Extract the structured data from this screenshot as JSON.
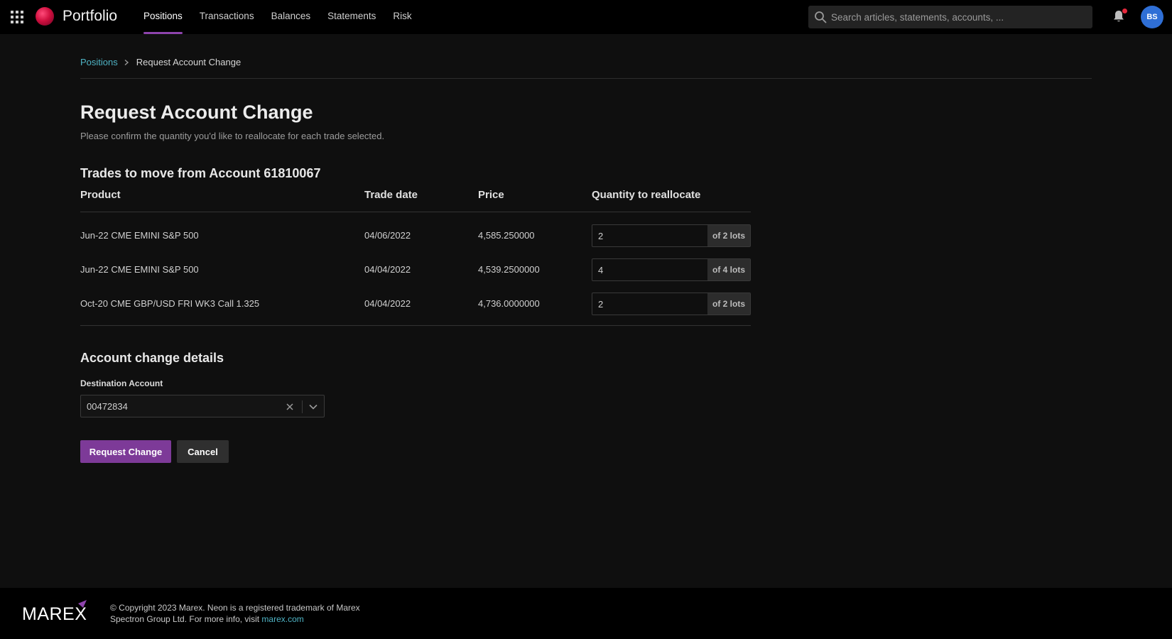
{
  "header": {
    "app_title": "Portfolio",
    "nav": [
      {
        "label": "Positions",
        "active": true
      },
      {
        "label": "Transactions"
      },
      {
        "label": "Balances"
      },
      {
        "label": "Statements"
      },
      {
        "label": "Risk"
      }
    ],
    "search_placeholder": "Search articles, statements, accounts, ...",
    "avatar_initials": "BS",
    "icons": [
      "apps-grid-icon",
      "logo-orb",
      "search-icon",
      "bell-icon"
    ],
    "colors": {
      "accent": "#8e44ad",
      "link": "#4fb3c4",
      "notification": "#e5283c",
      "avatar": "#2f6fd6"
    }
  },
  "breadcrumb": {
    "parent": "Positions",
    "current": "Request Account Change"
  },
  "page": {
    "title": "Request Account Change",
    "subtitle": "Please confirm the quantity you'd like to reallocate for each trade selected."
  },
  "trades": {
    "title": "Trades to move from Account 61810067",
    "columns": [
      "Product",
      "Trade date",
      "Price",
      "Quantity to reallocate"
    ],
    "rows": [
      {
        "product": "Jun-22 CME EMINI S&P 500",
        "trade_date": "04/06/2022",
        "price": "4,585.250000",
        "quantity": "2",
        "of_lots": "of 2 lots"
      },
      {
        "product": "Jun-22 CME EMINI S&P 500",
        "trade_date": "04/04/2022",
        "price": "4,539.2500000",
        "quantity": "4",
        "of_lots": "of 4 lots"
      },
      {
        "product": "Oct-20 CME GBP/USD FRI WK3 Call 1.325",
        "trade_date": "04/04/2022",
        "price": "4,736.0000000",
        "quantity": "2",
        "of_lots": "of 2 lots"
      }
    ]
  },
  "details": {
    "title": "Account change details",
    "destination_label": "Destination Account",
    "destination_value": "00472834"
  },
  "actions": {
    "primary": "Request Change",
    "secondary": "Cancel"
  },
  "footer": {
    "logo_text": "MAREX",
    "text": "© Copyright 2023 Marex. Neon is a registered trademark of Marex Spectron Group Ltd. For more info, visit ",
    "link": "marex.com"
  }
}
